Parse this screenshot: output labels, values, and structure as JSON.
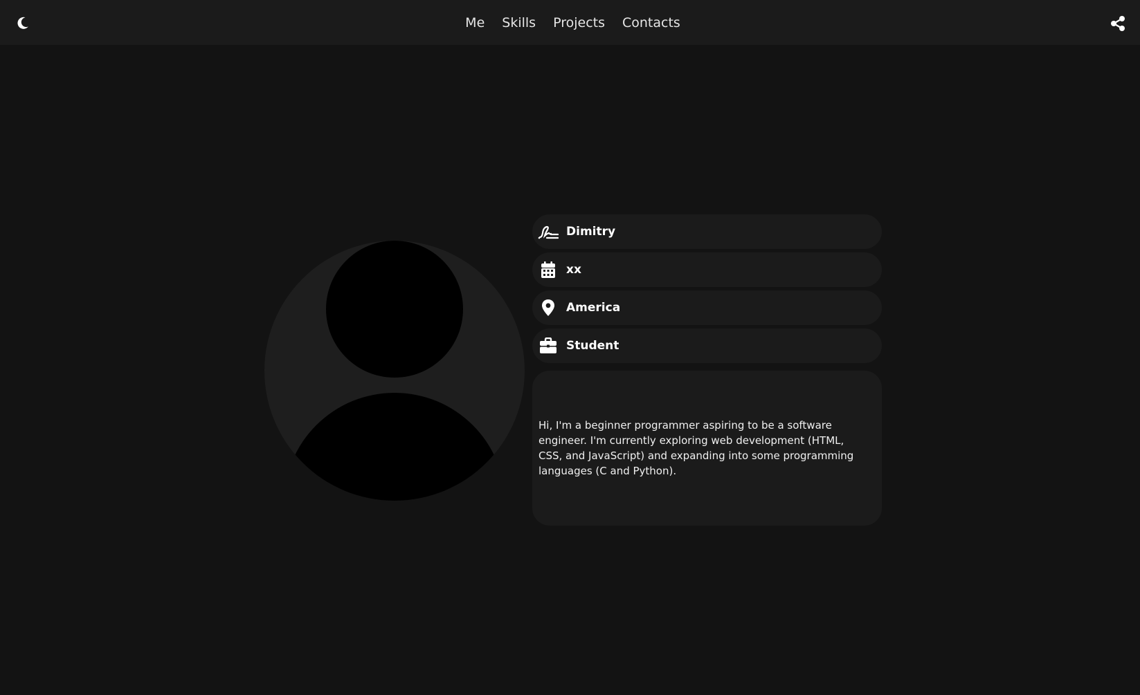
{
  "nav": {
    "items": [
      "Me",
      "Skills",
      "Projects",
      "Contacts"
    ]
  },
  "icons": {
    "theme": "moon-icon",
    "share": "share-icon",
    "name": "signature-icon",
    "birthdate": "calendar-icon",
    "location": "map-pin-icon",
    "occupation": "briefcase-icon"
  },
  "profile": {
    "name": "Dimitry",
    "birthdate": "xx",
    "location": "America",
    "occupation": "Student",
    "bio": "Hi, I'm a beginner programmer aspiring to be a software engineer. I'm currently exploring web development (HTML, CSS, and JavaScript) and expanding into some programming languages (C and Python)."
  },
  "colors": {
    "background": "#131313",
    "bar": "#1b1b1b",
    "card": "#1b1b1b",
    "avatar_bg": "#1e1e1e",
    "text": "#ffffff"
  }
}
